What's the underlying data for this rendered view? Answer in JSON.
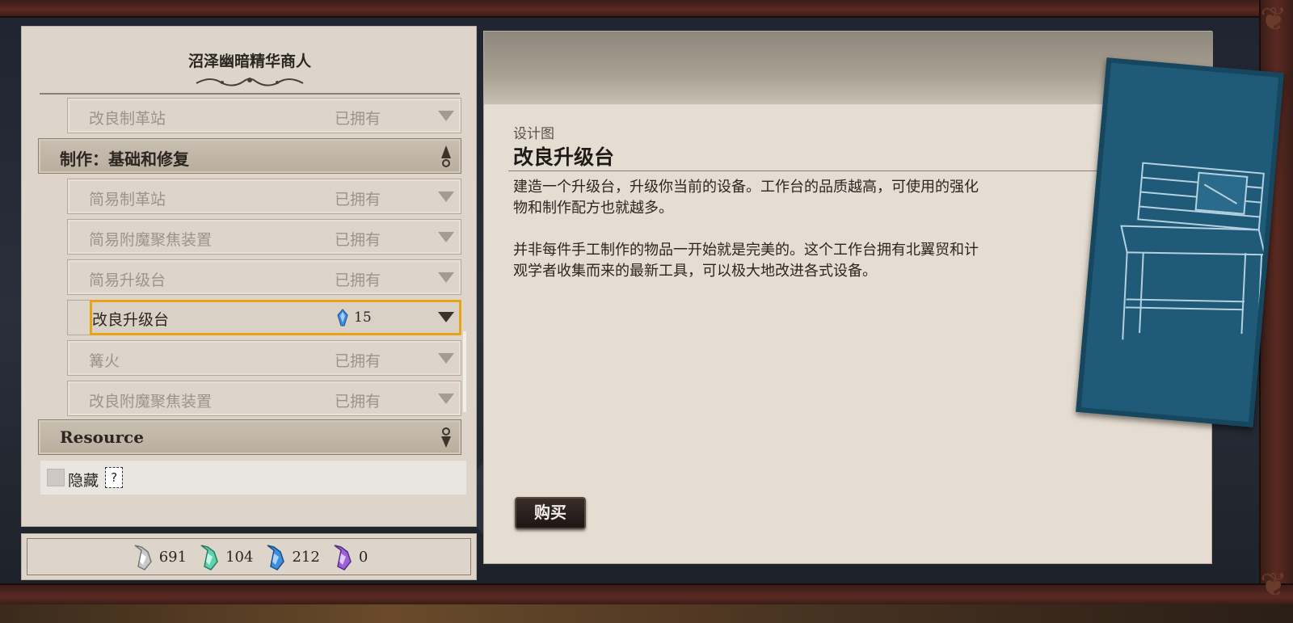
{
  "merchant": {
    "title": "沼泽幽暗精华商人"
  },
  "list": {
    "rows": [
      {
        "kind": "item",
        "name": "改良制革站",
        "status": "已拥有"
      },
      {
        "kind": "category",
        "label": "制作：基础和修复"
      },
      {
        "kind": "item",
        "name": "简易制革站",
        "status": "已拥有"
      },
      {
        "kind": "item",
        "name": "简易附魔聚焦装置",
        "status": "已拥有"
      },
      {
        "kind": "item",
        "name": "简易升级台",
        "status": "已拥有"
      },
      {
        "kind": "selected",
        "name": "改良升级台",
        "price": "15"
      },
      {
        "kind": "item",
        "name": "篝火",
        "status": "已拥有"
      },
      {
        "kind": "item",
        "name": "改良附魔聚焦装置",
        "status": "已拥有"
      },
      {
        "kind": "category",
        "label": "Resource"
      }
    ]
  },
  "hide": {
    "label": "隐藏",
    "help": "?"
  },
  "currencies": [
    {
      "icon": "white-essence-icon",
      "value": "691",
      "color": "#c9c9c9"
    },
    {
      "icon": "green-essence-icon",
      "value": "104",
      "color": "#5fd3b0"
    },
    {
      "icon": "blue-essence-icon",
      "value": "212",
      "color": "#3c8ee0"
    },
    {
      "icon": "purple-essence-icon",
      "value": "0",
      "color": "#9a62d6"
    }
  ],
  "detail": {
    "type": "设计图",
    "name": "改良升级台",
    "description": [
      "建造一个升级台，升级你当前的设备。工作台的品质越高，可使用的强化物和制作配方也就越多。",
      "并非每件手工制作的物品一开始就是完美的。这个工作台拥有北翼贸和计观学者收集而来的最新工具，可以极大地改进各式设备。"
    ],
    "buy_label": "购买"
  },
  "colors": {
    "highlight": "#e8a317",
    "panel": "#ddd5ca",
    "blueprint": "#1f5a78"
  }
}
